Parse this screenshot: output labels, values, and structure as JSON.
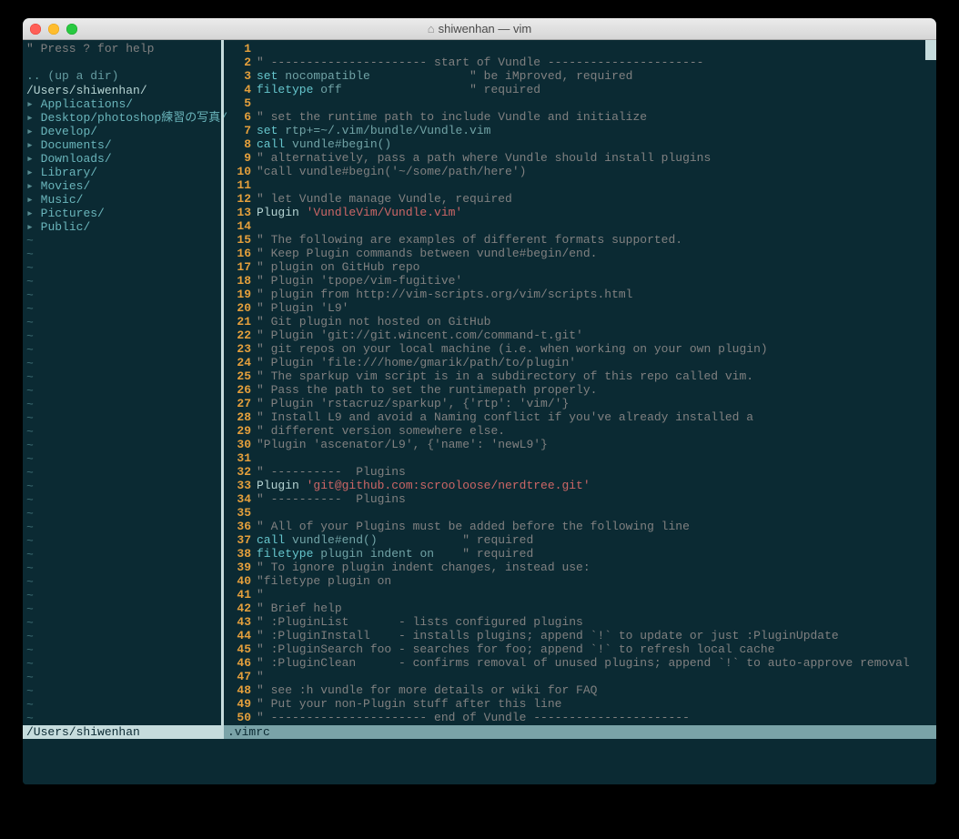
{
  "window": {
    "title": "shiwenhan — vim"
  },
  "nerdtree": {
    "help": "\" Press ? for help",
    "updir": ".. (up a dir)",
    "path": "/Users/shiwenhan/",
    "items": [
      "Applications/",
      "Desktop/photoshop練習の写真/",
      "Develop/",
      "Documents/",
      "Downloads/",
      "Library/",
      "Movies/",
      "Music/",
      "Pictures/",
      "Public/"
    ]
  },
  "editor": {
    "lines": [
      {
        "n": 1,
        "t": ""
      },
      {
        "n": 2,
        "t": "\" ---------------------- start of Vundle ----------------------",
        "c": "cmt"
      },
      {
        "n": 3,
        "t": "set nocompatible              \" be iMproved, required",
        "mix": [
          {
            "t": "set",
            "c": "kw"
          },
          {
            "t": " nocompatible              ",
            "c": ""
          },
          {
            "t": "\" be iMproved, required",
            "c": "cmt"
          }
        ]
      },
      {
        "n": 4,
        "t": "filetype off                  \" required",
        "mix": [
          {
            "t": "filetype",
            "c": "kw"
          },
          {
            "t": " off                  ",
            "c": ""
          },
          {
            "t": "\" required",
            "c": "cmt"
          }
        ]
      },
      {
        "n": 5,
        "t": ""
      },
      {
        "n": 6,
        "t": "\" set the runtime path to include Vundle and initialize",
        "c": "cmt"
      },
      {
        "n": 7,
        "t": "set rtp+=~/.vim/bundle/Vundle.vim",
        "mix": [
          {
            "t": "set",
            "c": "kw"
          },
          {
            "t": " rtp+=~/.vim/bundle/Vundle.vim",
            "c": ""
          }
        ]
      },
      {
        "n": 8,
        "t": "call vundle#begin()",
        "mix": [
          {
            "t": "call",
            "c": "kw"
          },
          {
            "t": " vundle#begin()",
            "c": ""
          }
        ]
      },
      {
        "n": 9,
        "t": "\" alternatively, pass a path where Vundle should install plugins",
        "c": "cmt"
      },
      {
        "n": 10,
        "t": "\"call vundle#begin('~/some/path/here')",
        "c": "cmt"
      },
      {
        "n": 11,
        "t": ""
      },
      {
        "n": 12,
        "t": "\" let Vundle manage Vundle, required",
        "c": "cmt"
      },
      {
        "n": 13,
        "t": "Plugin 'VundleVim/Vundle.vim'",
        "mix": [
          {
            "t": "Plugin ",
            "c": "cmd"
          },
          {
            "t": "'VundleVim/Vundle.vim'",
            "c": "str"
          }
        ]
      },
      {
        "n": 14,
        "t": ""
      },
      {
        "n": 15,
        "t": "\" The following are examples of different formats supported.",
        "c": "cmt"
      },
      {
        "n": 16,
        "t": "\" Keep Plugin commands between vundle#begin/end.",
        "c": "cmt"
      },
      {
        "n": 17,
        "t": "\" plugin on GitHub repo",
        "c": "cmt"
      },
      {
        "n": 18,
        "t": "\" Plugin 'tpope/vim-fugitive'",
        "c": "cmt"
      },
      {
        "n": 19,
        "t": "\" plugin from http://vim-scripts.org/vim/scripts.html",
        "c": "cmt"
      },
      {
        "n": 20,
        "t": "\" Plugin 'L9'",
        "c": "cmt"
      },
      {
        "n": 21,
        "t": "\" Git plugin not hosted on GitHub",
        "c": "cmt"
      },
      {
        "n": 22,
        "t": "\" Plugin 'git://git.wincent.com/command-t.git'",
        "c": "cmt"
      },
      {
        "n": 23,
        "t": "\" git repos on your local machine (i.e. when working on your own plugin)",
        "c": "cmt"
      },
      {
        "n": 24,
        "t": "\" Plugin 'file:///home/gmarik/path/to/plugin'",
        "c": "cmt"
      },
      {
        "n": 25,
        "t": "\" The sparkup vim script is in a subdirectory of this repo called vim.",
        "c": "cmt"
      },
      {
        "n": 26,
        "t": "\" Pass the path to set the runtimepath properly.",
        "c": "cmt"
      },
      {
        "n": 27,
        "t": "\" Plugin 'rstacruz/sparkup', {'rtp': 'vim/'}",
        "c": "cmt"
      },
      {
        "n": 28,
        "t": "\" Install L9 and avoid a Naming conflict if you've already installed a",
        "c": "cmt"
      },
      {
        "n": 29,
        "t": "\" different version somewhere else.",
        "c": "cmt"
      },
      {
        "n": 30,
        "t": "\"Plugin 'ascenator/L9', {'name': 'newL9'}",
        "c": "cmt"
      },
      {
        "n": 31,
        "t": ""
      },
      {
        "n": 32,
        "t": "\" ----------  Plugins",
        "c": "cmt"
      },
      {
        "n": 33,
        "t": "Plugin 'git@github.com:scrooloose/nerdtree.git'",
        "mix": [
          {
            "t": "Plugin ",
            "c": "cmd"
          },
          {
            "t": "'git@github.com:scrooloose/nerdtree.git'",
            "c": "str"
          }
        ]
      },
      {
        "n": 34,
        "t": "\" ----------  Plugins",
        "c": "cmt"
      },
      {
        "n": 35,
        "t": ""
      },
      {
        "n": 36,
        "t": "\" All of your Plugins must be added before the following line",
        "c": "cmt"
      },
      {
        "n": 37,
        "t": "call vundle#end()            \" required",
        "mix": [
          {
            "t": "call",
            "c": "kw"
          },
          {
            "t": " vundle#end()            ",
            "c": ""
          },
          {
            "t": "\" required",
            "c": "cmt"
          }
        ]
      },
      {
        "n": 38,
        "t": "filetype plugin indent on    \" required",
        "mix": [
          {
            "t": "filetype",
            "c": "kw"
          },
          {
            "t": " plugin indent on    ",
            "c": ""
          },
          {
            "t": "\" required",
            "c": "cmt"
          }
        ]
      },
      {
        "n": 39,
        "t": "\" To ignore plugin indent changes, instead use:",
        "c": "cmt"
      },
      {
        "n": 40,
        "t": "\"filetype plugin on",
        "c": "cmt"
      },
      {
        "n": 41,
        "t": "\"",
        "c": "cmt"
      },
      {
        "n": 42,
        "t": "\" Brief help",
        "c": "cmt"
      },
      {
        "n": 43,
        "t": "\" :PluginList       - lists configured plugins",
        "c": "cmt"
      },
      {
        "n": 44,
        "t": "\" :PluginInstall    - installs plugins; append `!` to update or just :PluginUpdate",
        "c": "cmt"
      },
      {
        "n": 45,
        "t": "\" :PluginSearch foo - searches for foo; append `!` to refresh local cache",
        "c": "cmt"
      },
      {
        "n": 46,
        "t": "\" :PluginClean      - confirms removal of unused plugins; append `!` to auto-approve removal",
        "c": "cmt"
      },
      {
        "n": 47,
        "t": "\"",
        "c": "cmt"
      },
      {
        "n": 48,
        "t": "\" see :h vundle for more details or wiki for FAQ",
        "c": "cmt"
      },
      {
        "n": 49,
        "t": "\" Put your non-Plugin stuff after this line",
        "c": "cmt"
      },
      {
        "n": 50,
        "t": "\" ---------------------- end of Vundle ----------------------",
        "c": "cmt"
      }
    ]
  },
  "status": {
    "left": "/Users/shiwenhan",
    "right": ".vimrc"
  }
}
